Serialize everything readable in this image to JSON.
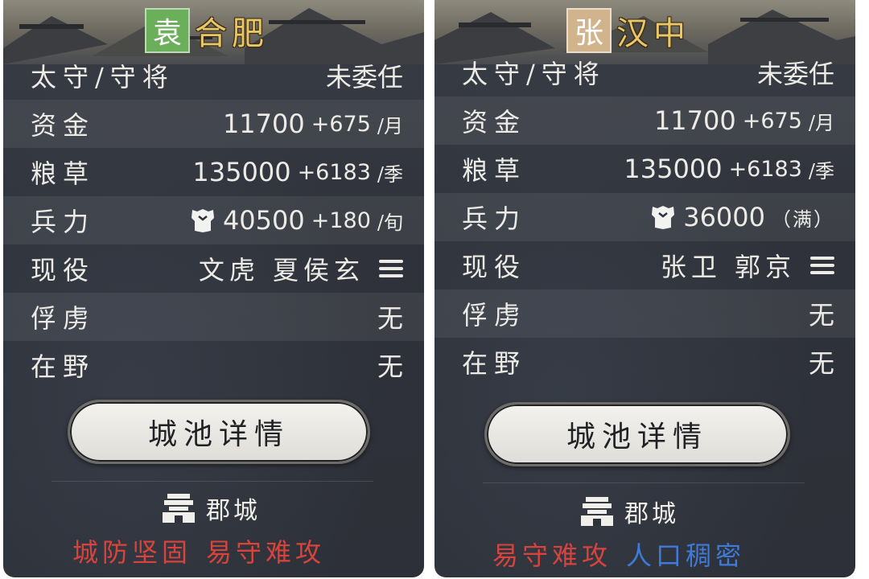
{
  "colors": {
    "lord_badge_green": "#6caf5b",
    "lord_badge_tan": "#d2b48c",
    "city_name_gold": "#e7c76a",
    "trait_red": "#d8443c",
    "trait_blue": "#3f7ad9",
    "panel_bg": "#2f323a"
  },
  "panels": [
    {
      "lord": "袁",
      "city": "合肥",
      "rows": {
        "governor": {
          "label": "太守/守将",
          "value": "未委任"
        },
        "funds": {
          "label": "资金",
          "amount": "11700",
          "delta": "+675",
          "unit": "/月"
        },
        "grain": {
          "label": "粮草",
          "amount": "135000",
          "delta": "+6183",
          "unit": "/季"
        },
        "troops": {
          "label": "兵力",
          "icon": "shield-icon",
          "amount": "40500",
          "delta": "+180",
          "unit": "/旬"
        },
        "active": {
          "label": "现役",
          "value": "文虎 夏侯玄",
          "icon": "menu-icon"
        },
        "captives": {
          "label": "俘虏",
          "value": "无"
        },
        "unassigned": {
          "label": "在野",
          "value": "无"
        }
      },
      "details_button": "城池详情",
      "city_type": {
        "icon": "fortress-icon",
        "label": "郡城"
      },
      "traits": [
        {
          "text": "城防坚固",
          "color": "#d8443c"
        },
        {
          "text": "易守难攻",
          "color": "#d8443c"
        }
      ]
    },
    {
      "lord": "张",
      "city": "汉中",
      "rows": {
        "governor": {
          "label": "太守/守将",
          "value": "未委任"
        },
        "funds": {
          "label": "资金",
          "amount": "11700",
          "delta": "+675",
          "unit": "/月"
        },
        "grain": {
          "label": "粮草",
          "amount": "135000",
          "delta": "+6183",
          "unit": "/季"
        },
        "troops": {
          "label": "兵力",
          "icon": "shield-icon",
          "amount": "36000",
          "delta": "（满）",
          "unit": ""
        },
        "active": {
          "label": "现役",
          "value": "张卫 郭京",
          "icon": "menu-icon"
        },
        "captives": {
          "label": "俘虏",
          "value": "无"
        },
        "unassigned": {
          "label": "在野",
          "value": "无"
        }
      },
      "details_button": "城池详情",
      "city_type": {
        "icon": "fortress-icon",
        "label": "郡城"
      },
      "traits": [
        {
          "text": "易守难攻",
          "color": "#d8443c"
        },
        {
          "text": "人口稠密",
          "color": "#3f7ad9"
        }
      ]
    }
  ]
}
